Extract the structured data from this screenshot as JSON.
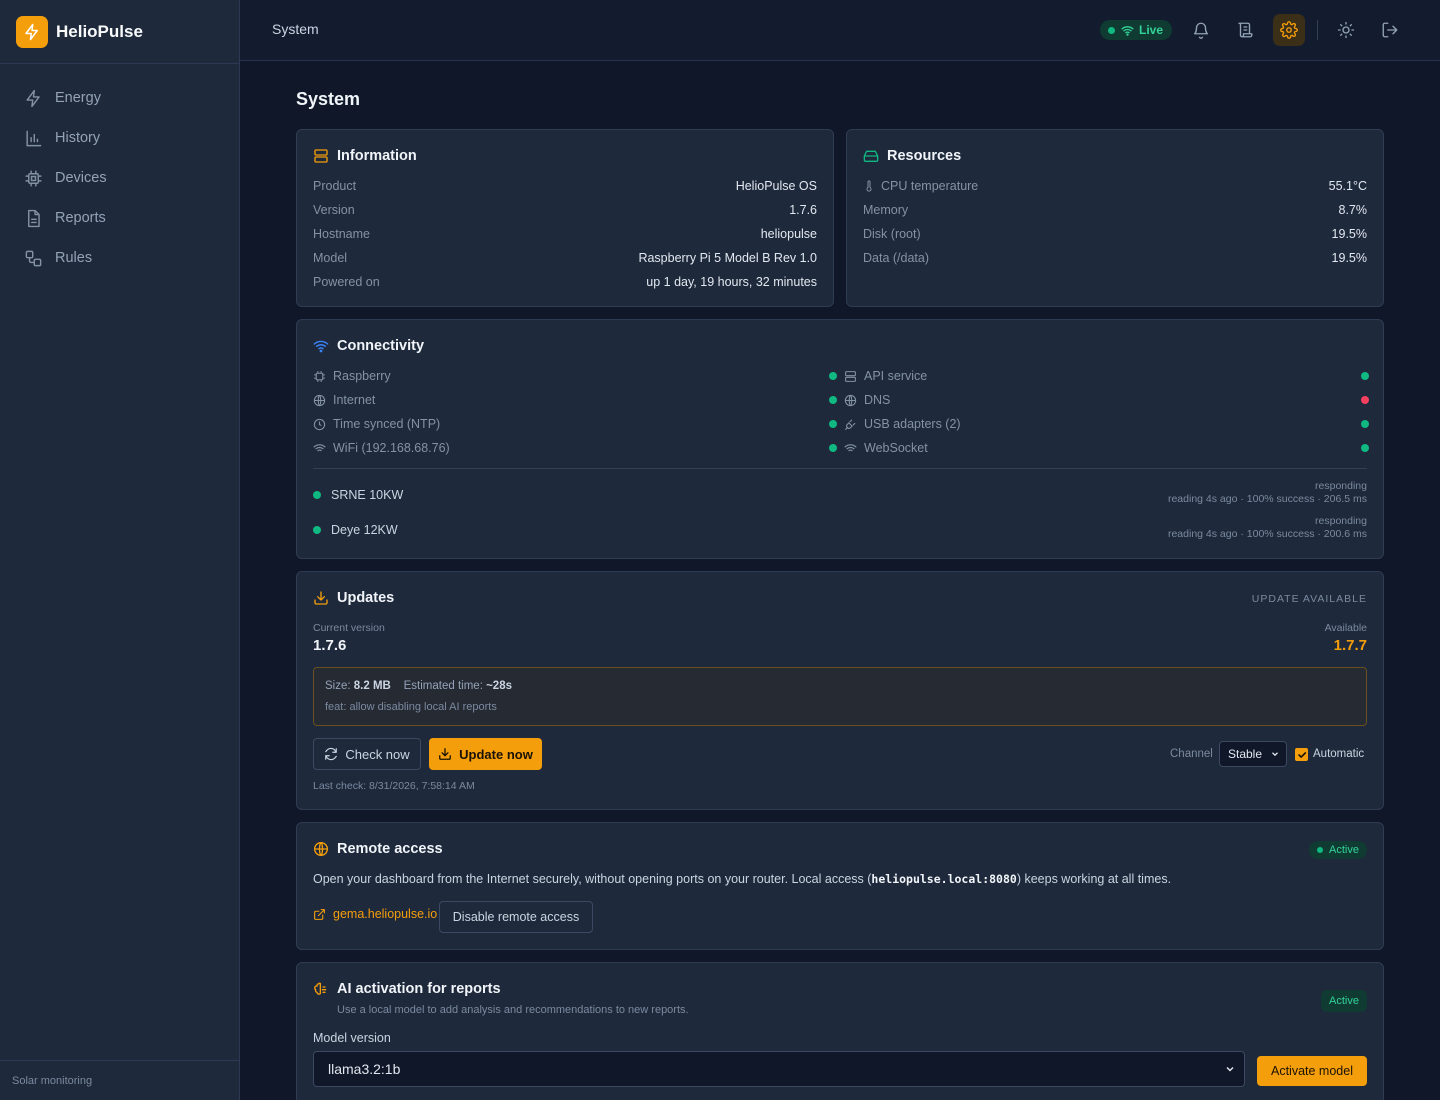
{
  "brand": {
    "name": "HelioPulse",
    "footer": "Solar monitoring"
  },
  "nav": [
    {
      "label": "Energy",
      "icon": "bolt-icon"
    },
    {
      "label": "History",
      "icon": "bar-chart-icon"
    },
    {
      "label": "Devices",
      "icon": "chip-icon"
    },
    {
      "label": "Reports",
      "icon": "document-icon"
    },
    {
      "label": "Rules",
      "icon": "workflow-icon"
    }
  ],
  "topbar": {
    "title": "System",
    "live": "Live"
  },
  "page": {
    "title": "System"
  },
  "information": {
    "title": "Information",
    "rows": [
      {
        "k": "Product",
        "v": "HelioPulse OS"
      },
      {
        "k": "Version",
        "v": "1.7.6"
      },
      {
        "k": "Hostname",
        "v": "heliopulse"
      },
      {
        "k": "Model",
        "v": "Raspberry Pi 5 Model B Rev 1.0"
      },
      {
        "k": "Powered on",
        "v": "up 1 day, 19 hours, 32 minutes"
      }
    ]
  },
  "resources": {
    "title": "Resources",
    "rows": [
      {
        "k": "CPU temperature",
        "v": "55.1°C"
      },
      {
        "k": "Memory",
        "v": "8.7%"
      },
      {
        "k": "Disk (root)",
        "v": "19.5%"
      },
      {
        "k": "Data (/data)",
        "v": "19.5%"
      }
    ]
  },
  "connectivity": {
    "title": "Connectivity",
    "left": [
      {
        "label": "Raspberry",
        "status": "ok"
      },
      {
        "label": "Internet",
        "status": "ok"
      },
      {
        "label": "Time synced (NTP)",
        "status": "ok"
      },
      {
        "label": "WiFi (192.168.68.76)",
        "status": "ok"
      }
    ],
    "right": [
      {
        "label": "API service",
        "status": "ok"
      },
      {
        "label": "DNS",
        "status": "error"
      },
      {
        "label": "USB adapters (2)",
        "status": "ok"
      },
      {
        "label": "WebSocket",
        "status": "ok"
      }
    ],
    "devices": [
      {
        "name": "SRNE 10KW",
        "status": "responding",
        "detail": "reading 4s ago · 100% success · 206.5 ms"
      },
      {
        "name": "Deye 12KW",
        "status": "responding",
        "detail": "reading 4s ago · 100% success · 200.6 ms"
      }
    ]
  },
  "updates": {
    "title": "Updates",
    "state": "UPDATE AVAILABLE",
    "current_label": "Current version",
    "current": "1.7.6",
    "available_label": "Available",
    "available": "1.7.7",
    "size_label": "Size:",
    "size": "8.2 MB",
    "time_label": "Estimated time:",
    "time": "~28s",
    "notes": "feat: allow disabling local AI reports",
    "check_label": "Check now",
    "update_label": "Update now",
    "channel_label": "Channel",
    "channel": "Stable",
    "automatic_label": "Automatic",
    "last_check": "Last check: 8/31/2026, 7:58:14 AM"
  },
  "remote": {
    "title": "Remote access",
    "badge": "Active",
    "desc_pre": "Open your dashboard from the Internet securely, without opening ports on your router. Local access (",
    "desc_code": "heliopulse.local:8080",
    "desc_post": ") keeps working at all times.",
    "link": "gema.heliopulse.io",
    "disable_label": "Disable remote access"
  },
  "ai": {
    "title": "AI activation for reports",
    "subtitle": "Use a local model to add analysis and recommendations to new reports.",
    "badge": "Active",
    "model_label": "Model version",
    "model": "llama3.2:1b",
    "activate_label": "Activate model"
  },
  "colors": {
    "accent": "#f59e0b",
    "ok": "#10b981",
    "error": "#f43f5e",
    "bg": "#0f1728",
    "card": "#1e293b"
  }
}
